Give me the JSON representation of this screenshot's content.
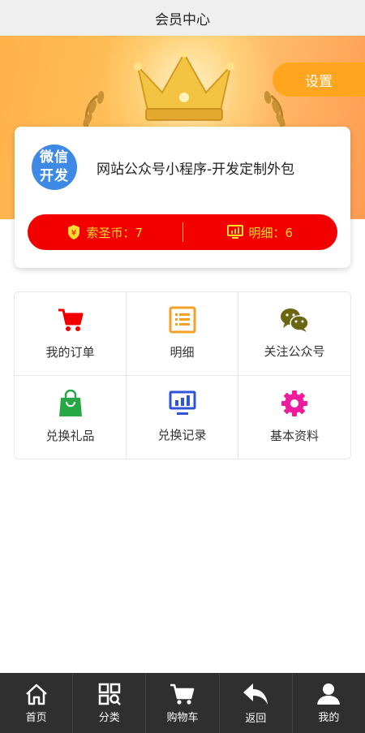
{
  "header": {
    "title": "会员中心"
  },
  "banner": {
    "settings_label": "设置"
  },
  "profile": {
    "avatar_line1": "微信",
    "avatar_line2": "开发",
    "name": "网站公众号小程序-开发定制外包",
    "coins_label": "索圣币：7",
    "detail_label": "明细：6",
    "accent_color": "#f20000",
    "highlight_color": "#ffdc2e"
  },
  "menu": [
    {
      "label": "我的订单",
      "icon": "cart-icon",
      "color": "#f20000"
    },
    {
      "label": "明细",
      "icon": "list-icon",
      "color": "#f4a12a"
    },
    {
      "label": "关注公众号",
      "icon": "wechat-icon",
      "color": "#6b6612"
    },
    {
      "label": "兑换礼品",
      "icon": "shopping-bag-icon",
      "color": "#28a745"
    },
    {
      "label": "兑换记录",
      "icon": "monitor-chart-icon",
      "color": "#2f55d4"
    },
    {
      "label": "基本资料",
      "icon": "gear-icon",
      "color": "#ee1c9c"
    }
  ],
  "tabbar": [
    {
      "label": "首页",
      "icon": "home-icon"
    },
    {
      "label": "分类",
      "icon": "category-icon"
    },
    {
      "label": "购物车",
      "icon": "cart-icon"
    },
    {
      "label": "返回",
      "icon": "back-arrow-icon"
    },
    {
      "label": "我的",
      "icon": "user-icon"
    }
  ]
}
